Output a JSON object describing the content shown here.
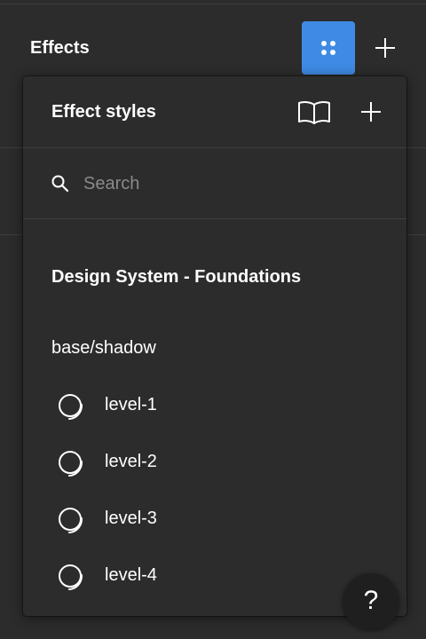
{
  "panel": {
    "title": "Effects"
  },
  "popover": {
    "title": "Effect styles",
    "search": {
      "placeholder": "Search",
      "value": ""
    },
    "library": "Design System - Foundations",
    "group": "base/shadow",
    "items": [
      {
        "label": "level-1"
      },
      {
        "label": "level-2"
      },
      {
        "label": "level-3"
      },
      {
        "label": "level-4"
      }
    ]
  },
  "help": {
    "label": "?"
  },
  "colors": {
    "background": "#2c2c2c",
    "accent": "#3f8ae4",
    "divider": "#3e3e3e",
    "placeholder": "#8a8a8a"
  },
  "icons": {
    "styles_toggle": "grid-dots-icon",
    "add": "plus-icon",
    "library": "book-icon",
    "search": "search-icon",
    "effect": "drop-shadow-icon",
    "help": "help-icon"
  }
}
